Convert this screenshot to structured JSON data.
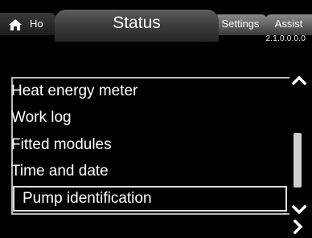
{
  "tabs": {
    "home_label": "Ho",
    "status_label": "Status",
    "settings_label": "Settings",
    "assist_label": "Assist"
  },
  "version": "2.1.0.0.0.0",
  "list": {
    "items": [
      {
        "label": "Heat energy meter"
      },
      {
        "label": "Work log"
      },
      {
        "label": "Fitted modules"
      },
      {
        "label": "Time and date"
      },
      {
        "label": "Pump identification",
        "selected": true
      }
    ]
  },
  "icons": {
    "home": "home-icon",
    "scroll_up": "chevron-up-icon",
    "scroll_down": "chevron-down-icon",
    "next": "chevron-right-icon"
  },
  "colors": {
    "background": "#000000",
    "text": "#ffffff",
    "scroll_thumb": "#cfcfcf"
  }
}
